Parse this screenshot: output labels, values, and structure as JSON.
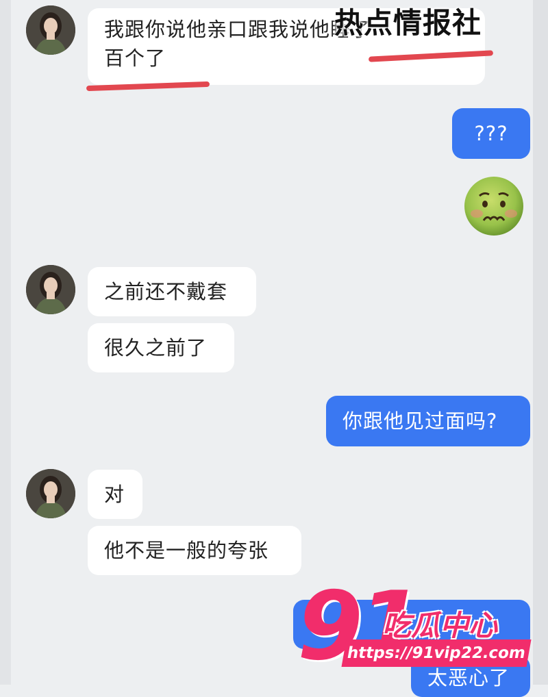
{
  "watermark_top": "热点情报社",
  "messages": {
    "m1": "我跟你说他亲口跟我说他睡了",
    "m1b": "百个了",
    "m2": "???",
    "m4": "之前还不戴套",
    "m5": "很久之前了",
    "m6": "你跟他见过面吗?",
    "m7": "对",
    "m8": "他不是一般的夸张",
    "m9": "太恶心了"
  },
  "emoji": "nauseated-face",
  "logo": {
    "number": "91",
    "name": "吃瓜中心",
    "url": "https://91vip22.com"
  },
  "colors": {
    "background": "#edeff1",
    "incoming_bubble": "#ffffff",
    "outgoing_bubble": "#3a78f2",
    "underline": "#e2474f",
    "logo": "#f12d6b"
  }
}
